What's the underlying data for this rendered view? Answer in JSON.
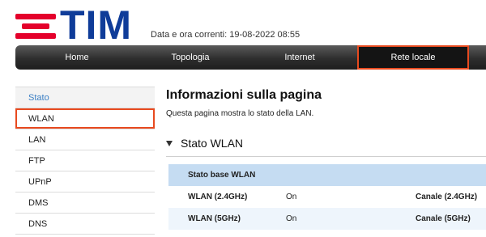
{
  "brand": {
    "logo_text": "TIM",
    "logo_color": "#0f3c99",
    "mark_color": "#e4002b"
  },
  "header": {
    "datetime": "Data e ora correnti: 19-08-2022 08:55"
  },
  "nav": {
    "items": [
      {
        "label": "Home"
      },
      {
        "label": "Topologia"
      },
      {
        "label": "Internet"
      },
      {
        "label": "Rete locale"
      }
    ],
    "active": "Rete locale"
  },
  "sidebar": {
    "items": [
      {
        "label": "Stato"
      },
      {
        "label": "WLAN"
      },
      {
        "label": "LAN"
      },
      {
        "label": "FTP"
      },
      {
        "label": "UPnP"
      },
      {
        "label": "DMS"
      },
      {
        "label": "DNS"
      }
    ],
    "selected": "WLAN"
  },
  "main": {
    "title": "Informazioni sulla pagina",
    "description": "Questa pagina mostra lo stato della LAN.",
    "section_title": "Stato WLAN",
    "table": {
      "header": "Stato base WLAN",
      "rows": [
        {
          "name": "WLAN (2.4GHz)",
          "value": "On",
          "channel_label": "Canale (2.4GHz)"
        },
        {
          "name": "WLAN (5GHz)",
          "value": "On",
          "channel_label": "Canale (5GHz)"
        }
      ]
    }
  },
  "colors": {
    "highlight": "#e84a1f",
    "link": "#3b7fc4",
    "table_header": "#c5dcf2"
  }
}
